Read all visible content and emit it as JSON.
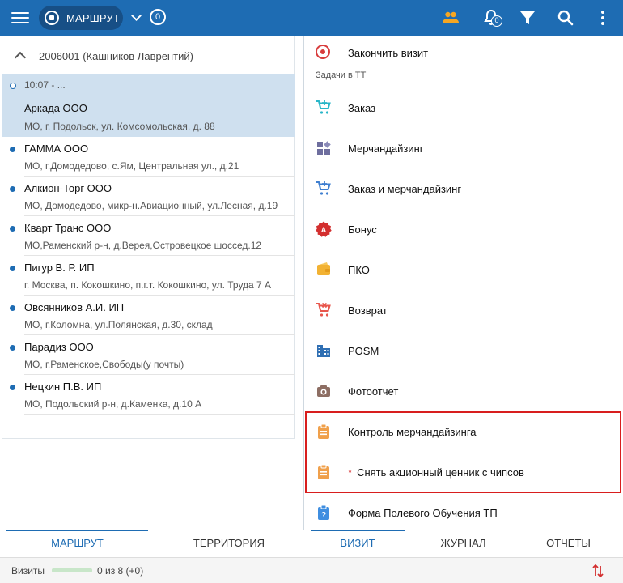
{
  "header": {
    "route_label": "МАРШРУТ",
    "route_count": "0",
    "notifications_count": "0",
    "icons": [
      "menu-icon",
      "route-icon",
      "chevron-down-icon",
      "people-icon",
      "bell-icon",
      "filter-icon",
      "search-icon",
      "more-vert-icon"
    ]
  },
  "left": {
    "agent": "2006001 (Кашников Лаврентий)",
    "active_item": {
      "time": "10:07 - ...",
      "name": "Аркада ООО",
      "address": "МО, г. Подольск, ул. Комсомольская, д. 88"
    },
    "items": [
      {
        "name": "ГАММА ООО",
        "address": "МО, г.Домодедово, с.Ям, Центральная ул., д.21"
      },
      {
        "name": "Алкион-Торг ООО",
        "address": "МО, Домодедово, микр-н.Авиационный, ул.Лесная, д.19"
      },
      {
        "name": "Кварт Транс ООО",
        "address": "МО,Раменский р-н, д.Верея,Островецкое шоссед.12"
      },
      {
        "name": "Пигур В. Р. ИП",
        "address": "г. Москва,  п. Кокошкино, п.г.т. Кокошкино, ул. Труда 7 А"
      },
      {
        "name": "Овсянников А.И. ИП",
        "address": "МО, г.Коломна, ул.Полянская, д.30, склад"
      },
      {
        "name": "Парадиз ООО",
        "address": "МО, г.Раменское,Свободы(у почты)"
      },
      {
        "name": "Нецкин П.В. ИП",
        "address": "МО, Подольский р-н, д.Каменка, д.10 А"
      }
    ],
    "tabs": {
      "route": "МАРШРУТ",
      "territory": "ТЕРРИТОРИЯ"
    }
  },
  "right": {
    "finish_visit": "Закончить визит",
    "tasks_header": "Задачи в ТТ",
    "tasks": [
      {
        "label": "Заказ",
        "icon": "cart-icon",
        "color": "#29b6c8"
      },
      {
        "label": "Мерчандайзинг",
        "icon": "merch-icon",
        "color": "#6e6e9e"
      },
      {
        "label": "Заказ и мерчандайзинг",
        "icon": "cart-merch-icon",
        "color": "#3f7fd0"
      },
      {
        "label": "Бонус",
        "icon": "bonus-icon",
        "color": "#d32f2f"
      },
      {
        "label": "ПКО",
        "icon": "wallet-icon",
        "color": "#f2b233"
      },
      {
        "label": "Возврат",
        "icon": "return-cart-icon",
        "color": "#e8574d"
      },
      {
        "label": "POSM",
        "icon": "posm-icon",
        "color": "#2f6fb3"
      },
      {
        "label": "Фотоотчет",
        "icon": "camera-icon",
        "color": "#8d6e63"
      },
      {
        "label": "Контроль мерчандайзинга",
        "icon": "clipboard-icon",
        "color": "#f0a04b"
      },
      {
        "label": "Снять акционный ценник с чипсов",
        "icon": "clipboard-icon",
        "color": "#f0a04b",
        "required_mark": "*"
      },
      {
        "label": "Форма Полевого Обучения ТП",
        "icon": "clipboard-question-icon",
        "color": "#3f8ee0"
      }
    ],
    "tabs": {
      "visit": "ВИЗИТ",
      "journal": "ЖУРНАЛ",
      "reports": "ОТЧЕТЫ"
    }
  },
  "status": {
    "visits_label": "Визиты",
    "visits_count": "0 из 8 (+0)",
    "visits_progress": 0
  }
}
